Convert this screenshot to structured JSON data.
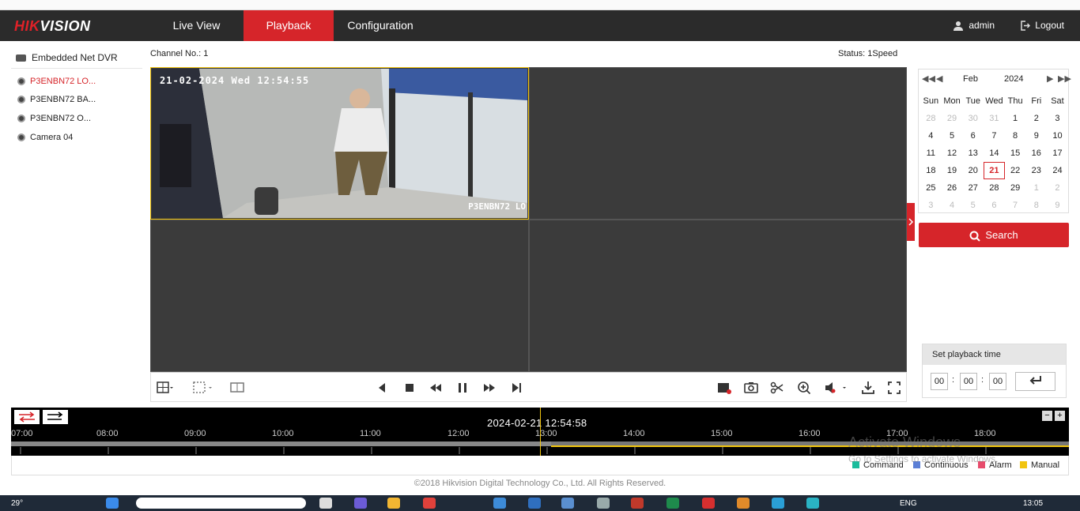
{
  "brand": {
    "red_part": "HIK",
    "white_part": "VISION"
  },
  "nav": {
    "tabs": [
      {
        "label": "Live View"
      },
      {
        "label": "Playback"
      },
      {
        "label": "Configuration"
      }
    ],
    "user": "admin",
    "logout": "Logout"
  },
  "sidebar": {
    "device": "Embedded Net DVR",
    "cameras": [
      {
        "label": "P3ENBN72 LO..."
      },
      {
        "label": "P3ENBN72 BA..."
      },
      {
        "label": "P3ENBN72 O..."
      },
      {
        "label": "Camera 04"
      }
    ]
  },
  "channel": {
    "label": "Channel No.: 1",
    "status": "Status: 1Speed"
  },
  "feed": {
    "osd_time": "21-02-2024 Wed 12:54:55",
    "osd_name": "P3ENBN72 LO"
  },
  "calendar": {
    "month": "Feb",
    "year": "2024",
    "weekdays": [
      "Sun",
      "Mon",
      "Tue",
      "Wed",
      "Thu",
      "Fri",
      "Sat"
    ],
    "weeks": [
      [
        "28",
        "29",
        "30",
        "31",
        "1",
        "2",
        "3"
      ],
      [
        "4",
        "5",
        "6",
        "7",
        "8",
        "9",
        "10"
      ],
      [
        "11",
        "12",
        "13",
        "14",
        "15",
        "16",
        "17"
      ],
      [
        "18",
        "19",
        "20",
        "21",
        "22",
        "23",
        "24"
      ],
      [
        "25",
        "26",
        "27",
        "28",
        "29",
        "1",
        "2"
      ],
      [
        "3",
        "4",
        "5",
        "6",
        "7",
        "8",
        "9"
      ]
    ],
    "today": "21"
  },
  "search": {
    "label": "Search"
  },
  "playback_time": {
    "title": "Set playback time",
    "hh": "00",
    "mm": "00",
    "ss": "00"
  },
  "timeline": {
    "stamp": "2024-02-21 12:54:58",
    "hours": [
      "07:00",
      "08:00",
      "09:00",
      "10:00",
      "11:00",
      "12:00",
      "13:00",
      "14:00",
      "15:00",
      "16:00",
      "17:00",
      "18:00"
    ]
  },
  "legend": [
    {
      "label": "Command",
      "color": "#1abc9c"
    },
    {
      "label": "Continuous",
      "color": "#5b7fd6"
    },
    {
      "label": "Alarm",
      "color": "#e74c6c"
    },
    {
      "label": "Manual",
      "color": "#f1c40f"
    }
  ],
  "copyright": "©2018 Hikvision Digital Technology Co., Ltd. All Rights Reserved.",
  "watermark": {
    "line1": "Activate Windows",
    "line2": "Go to Settings to activate Windows."
  },
  "taskbar": {
    "weather": "29°",
    "lang": "ENG",
    "clock": "13:05"
  },
  "colors": {
    "accent": "#d6252a",
    "navbar": "#2b2b2b"
  }
}
